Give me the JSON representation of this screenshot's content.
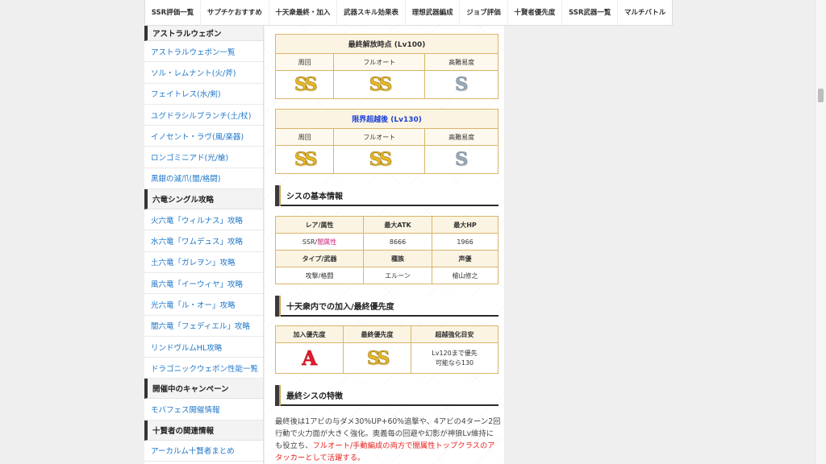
{
  "topnav": {
    "items": [
      "SSR評価一覧",
      "サプチケおすすめ",
      "十天衆最終・加入",
      "武器スキル効果表",
      "理想武器編成",
      "ジョブ評価",
      "十賢者優先度",
      "SSR武器一覧",
      "マルチバトル"
    ]
  },
  "sidebar": {
    "astral_head": "アストラルウェポン",
    "astral_links": [
      "アストラルウェポン一覧",
      "ソル・レムナント(火/斧)",
      "フェイトレス(水/剣)",
      "ユグドラシルブランチ(土/杖)",
      "イノセント・ラヴ(風/楽器)",
      "ロンゴミニアド(光/槍)",
      "黒銀の滅爪(闇/格闘)"
    ],
    "dragon_head": "六竜シングル攻略",
    "dragon_links": [
      "火六竜「ウィルナス」攻略",
      "水六竜「ワムデュス」攻略",
      "土六竜「ガレヲン」攻略",
      "風六竜「イーウィヤ」攻略",
      "光六竜「ル・オー」攻略",
      "闇六竜「フェディエル」攻略",
      "リンドヴルムHL攻略",
      "ドラゴニックウェポン性能一覧"
    ],
    "campaign_head": "開催中のキャンペーン",
    "campaign_links": [
      "モバフェス開催情報"
    ],
    "sage_head": "十賢者の関連情報",
    "sage_links": [
      "アーカルム十賢者まとめ"
    ]
  },
  "table_final": {
    "caption": "最終解放時点 (Lv100)",
    "cols": [
      "周回",
      "フルオート",
      "高難易度"
    ],
    "ranks": [
      "SS",
      "SS",
      "S"
    ]
  },
  "table_limit": {
    "caption": "限界超越後 (Lv130)",
    "cols": [
      "周回",
      "フルオート",
      "高難易度"
    ],
    "ranks": [
      "SS",
      "SS",
      "S"
    ]
  },
  "basic_info": {
    "title": "シスの基本情報",
    "header1": [
      "レア/属性",
      "最大ATK",
      "最大HP"
    ],
    "rarity": "SSR/",
    "element": "闇属性",
    "atk": "8666",
    "hp": "1966",
    "header2": [
      "タイプ/武器",
      "種族",
      "声優"
    ],
    "type": "攻撃/格闘",
    "race": "エルーン",
    "voice": "檜山修之"
  },
  "priority": {
    "title": "十天衆内での加入/最終優先度",
    "cols": [
      "加入優先度",
      "最終優先度",
      "超越強化目安"
    ],
    "join": "A",
    "final": "SS",
    "guide_line1": "Lv120まで優先",
    "guide_line2": "可能なら130"
  },
  "features": {
    "title": "最終シスの特徴",
    "text1": "最終後は1アビの与ダメ30%UP+60%追撃や、4アビの4ターン2回行動で火力面が大きく強化。奥義毎の回避や幻影が神狼Lv維持にも役立ち、",
    "red": "フルオート/手動編成の両方で闇属性トップクラスのアタッカーとして活躍する。"
  },
  "colors": {
    "gold_border": "#d9b56b",
    "link_blue": "#1f77c9",
    "ss_gold": "#e7b726",
    "s_silver": "#9aa9b8",
    "a_red": "#e31b2f",
    "highlight_red": "#e82020"
  }
}
